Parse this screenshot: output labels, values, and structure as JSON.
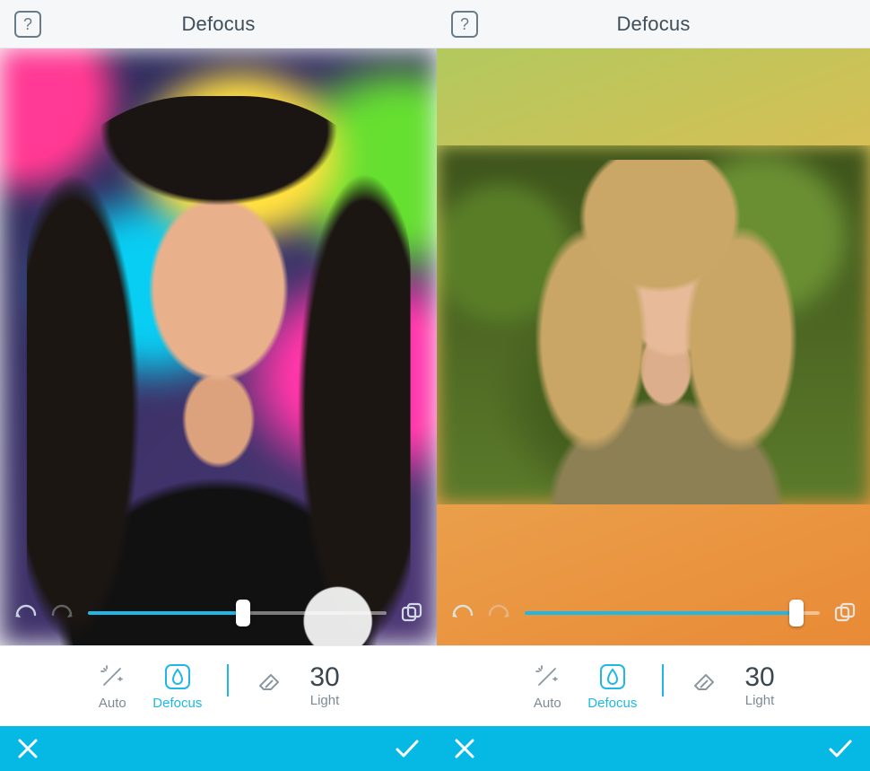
{
  "screens": [
    {
      "title": "Defocus",
      "help_glyph": "?",
      "slider": {
        "value_pct": 52,
        "fill_pct": 52
      },
      "undo_enabled": true,
      "redo_enabled": false,
      "tools": {
        "auto": "Auto",
        "defocus": "Defocus",
        "light_value": "30",
        "light_label": "Light"
      },
      "icons": {
        "undo": "undo-icon",
        "redo": "redo-icon",
        "compare": "compare-icon",
        "wand": "wand-icon",
        "blur": "blur-icon",
        "eraser": "eraser-icon",
        "cancel": "cancel-icon",
        "confirm": "confirm-icon"
      },
      "colors": {
        "accent": "#1fb7e6",
        "bar": "#06b8e4",
        "text": "#3e4e5a",
        "muted": "#7c8a95"
      }
    },
    {
      "title": "Defocus",
      "help_glyph": "?",
      "slider": {
        "value_pct": 92,
        "fill_pct": 92
      },
      "undo_enabled": true,
      "redo_enabled": false,
      "tools": {
        "auto": "Auto",
        "defocus": "Defocus",
        "light_value": "30",
        "light_label": "Light"
      },
      "icons": {
        "undo": "undo-icon",
        "redo": "redo-icon",
        "compare": "compare-icon",
        "wand": "wand-icon",
        "blur": "blur-icon",
        "eraser": "eraser-icon",
        "cancel": "cancel-icon",
        "confirm": "confirm-icon"
      },
      "colors": {
        "accent": "#1fb7e6",
        "bar": "#06b8e4",
        "text": "#3e4e5a",
        "muted": "#7c8a95"
      }
    }
  ]
}
